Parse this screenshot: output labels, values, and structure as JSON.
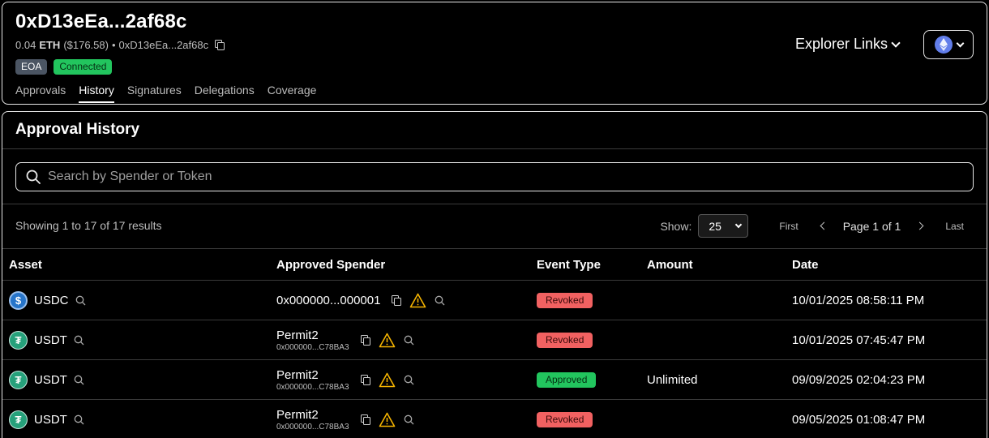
{
  "header": {
    "address_title": "0xD13eEa...2af68c",
    "balance_amount": "0.04",
    "balance_symbol": "ETH",
    "balance_usd": "($176.58)",
    "separator": "•",
    "address_short": "0xD13eEa...2af68c",
    "badges": {
      "eoa": "EOA",
      "connected": "Connected"
    },
    "tabs": [
      "Approvals",
      "History",
      "Signatures",
      "Delegations",
      "Coverage"
    ],
    "active_tab": "History",
    "explorer_links": "Explorer Links",
    "chain_icon": "ethereum-icon"
  },
  "section": {
    "title": "Approval History",
    "search_placeholder": "Search by Spender or Token"
  },
  "pagination": {
    "showing": "Showing 1 to 17 of 17 results",
    "show_label": "Show:",
    "page_size": "25",
    "first": "First",
    "page_info": "Page 1 of 1",
    "last": "Last"
  },
  "table": {
    "headers": [
      "Asset",
      "Approved Spender",
      "Event Type",
      "Amount",
      "Date"
    ],
    "rows": [
      {
        "asset": "USDC",
        "asset_icon": "usdc-icon",
        "spender": "0x000000...000001",
        "spender_sub": "",
        "event": "Revoked",
        "amount": "",
        "date": "10/01/2025 08:58:11 PM"
      },
      {
        "asset": "USDT",
        "asset_icon": "usdt-icon",
        "spender": "Permit2",
        "spender_sub": "0x000000...C78BA3",
        "event": "Revoked",
        "amount": "",
        "date": "10/01/2025 07:45:47 PM"
      },
      {
        "asset": "USDT",
        "asset_icon": "usdt-icon",
        "spender": "Permit2",
        "spender_sub": "0x000000...C78BA3",
        "event": "Approved",
        "amount": "Unlimited",
        "date": "09/09/2025 02:04:23 PM"
      },
      {
        "asset": "USDT",
        "asset_icon": "usdt-icon",
        "spender": "Permit2",
        "spender_sub": "0x000000...C78BA3",
        "event": "Revoked",
        "amount": "",
        "date": "09/05/2025 01:08:47 PM"
      }
    ]
  },
  "colors": {
    "connected": "#22c55e",
    "revoked": "#f16161",
    "approved": "#22c55e",
    "warning": "#f5b400",
    "usdc": "#2775ca",
    "usdt": "#26a17b",
    "eth": "#627eea"
  }
}
